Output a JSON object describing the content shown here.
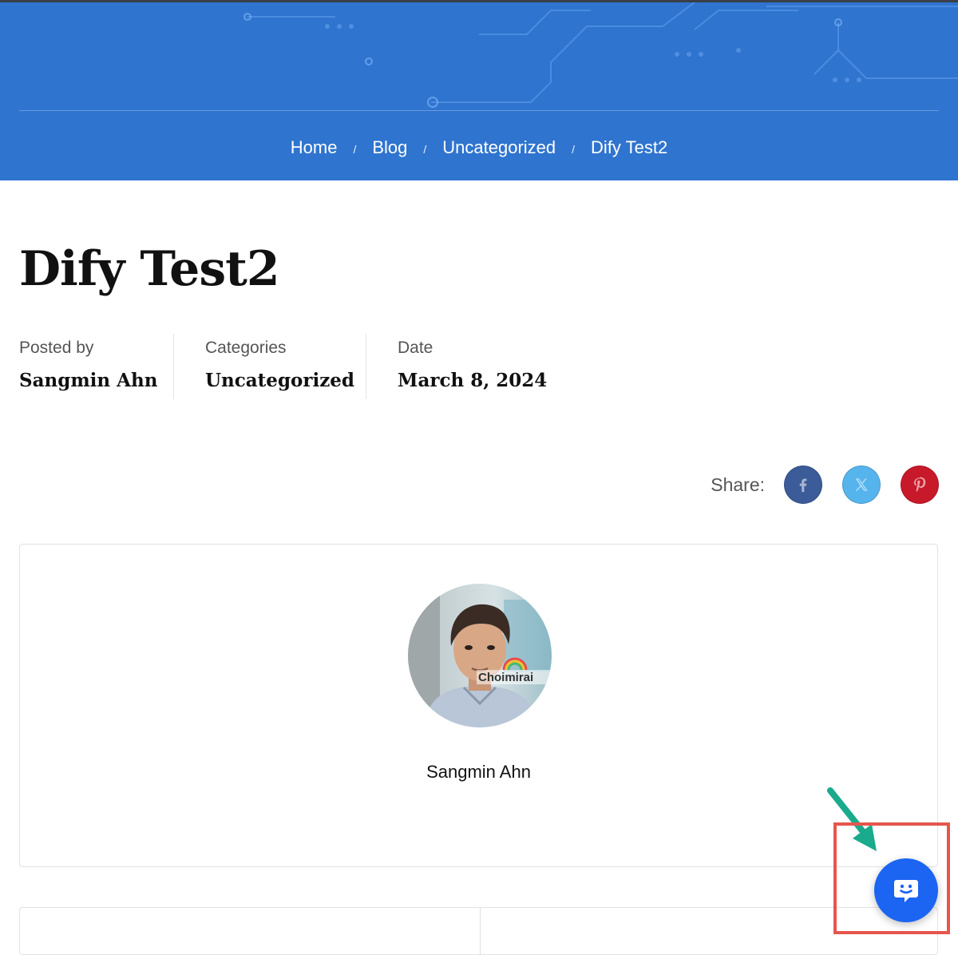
{
  "breadcrumb": {
    "items": [
      "Home",
      "Blog",
      "Uncategorized",
      "Dify Test2"
    ],
    "separator": "/"
  },
  "post": {
    "title": "Dify Test2",
    "meta": {
      "posted_by_label": "Posted by",
      "posted_by_value": "Sangmin Ahn",
      "categories_label": "Categories",
      "categories_value": "Uncategorized",
      "date_label": "Date",
      "date_value": "March 8, 2024"
    }
  },
  "share": {
    "label": "Share:",
    "buttons": [
      {
        "icon": "facebook-icon",
        "color": "#3b5b99"
      },
      {
        "icon": "x-twitter-icon",
        "color": "#56b4ed"
      },
      {
        "icon": "pinterest-icon",
        "color": "#c8192a"
      }
    ]
  },
  "author_card": {
    "name": "Sangmin Ahn",
    "avatar_text": "Choimirai"
  },
  "chat_widget": {
    "icon": "chat-bubble-smile-icon",
    "color": "#1c64f2",
    "highlight_color": "#e5564d",
    "arrow_color": "#1aaa8c"
  },
  "colors": {
    "hero_background": "#2f74cf"
  }
}
